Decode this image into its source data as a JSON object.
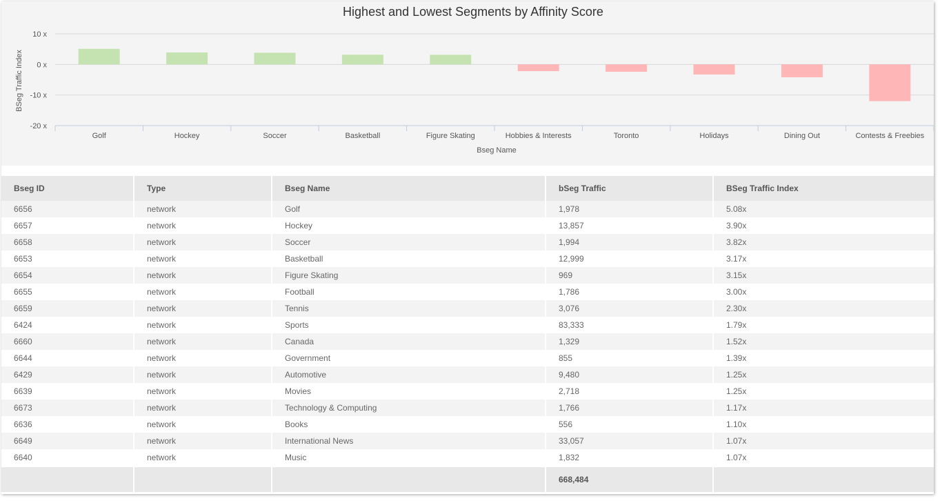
{
  "chart_data": {
    "type": "bar",
    "title": "Highest and Lowest Segments by Affinity Score",
    "xlabel": "Bseg Name",
    "ylabel": "BSeg Traffic Index",
    "ylim": [
      -20,
      10
    ],
    "yticks": [
      10,
      0,
      -10,
      -20
    ],
    "ytick_labels": [
      "10 x",
      "0 x",
      "-10 x",
      "-20 x"
    ],
    "grid": true,
    "categories": [
      "Golf",
      "Hockey",
      "Soccer",
      "Basketball",
      "Figure Skating",
      "Hobbies & Interests",
      "Toronto",
      "Holidays",
      "Dining Out",
      "Contests & Freebies"
    ],
    "values": [
      5.08,
      3.9,
      3.82,
      3.17,
      3.15,
      -2.2,
      -2.4,
      -3.3,
      -4.2,
      -12.0
    ],
    "colors": {
      "positive": "#c5e3b0",
      "negative": "#ffb6b6"
    }
  },
  "table": {
    "columns": [
      "Bseg ID",
      "Type",
      "Bseg Name",
      "bSeg Traffic",
      "BSeg Traffic Index"
    ],
    "rows": [
      [
        "6656",
        "network",
        "Golf",
        "1,978",
        "5.08x"
      ],
      [
        "6657",
        "network",
        "Hockey",
        "13,857",
        "3.90x"
      ],
      [
        "6658",
        "network",
        "Soccer",
        "1,994",
        "3.82x"
      ],
      [
        "6653",
        "network",
        "Basketball",
        "12,999",
        "3.17x"
      ],
      [
        "6654",
        "network",
        "Figure Skating",
        "969",
        "3.15x"
      ],
      [
        "6655",
        "network",
        "Football",
        "1,786",
        "3.00x"
      ],
      [
        "6659",
        "network",
        "Tennis",
        "3,076",
        "2.30x"
      ],
      [
        "6424",
        "network",
        "Sports",
        "83,333",
        "1.79x"
      ],
      [
        "6660",
        "network",
        "Canada",
        "1,329",
        "1.52x"
      ],
      [
        "6644",
        "network",
        "Government",
        "855",
        "1.39x"
      ],
      [
        "6429",
        "network",
        "Automotive",
        "9,480",
        "1.25x"
      ],
      [
        "6639",
        "network",
        "Movies",
        "2,718",
        "1.25x"
      ],
      [
        "6673",
        "network",
        "Technology & Computing",
        "1,766",
        "1.17x"
      ],
      [
        "6636",
        "network",
        "Books",
        "556",
        "1.10x"
      ],
      [
        "6649",
        "network",
        "International News",
        "33,057",
        "1.07x"
      ],
      [
        "6640",
        "network",
        "Music",
        "1,832",
        "1.07x"
      ]
    ],
    "footer": {
      "traffic_total": "668,484"
    }
  }
}
